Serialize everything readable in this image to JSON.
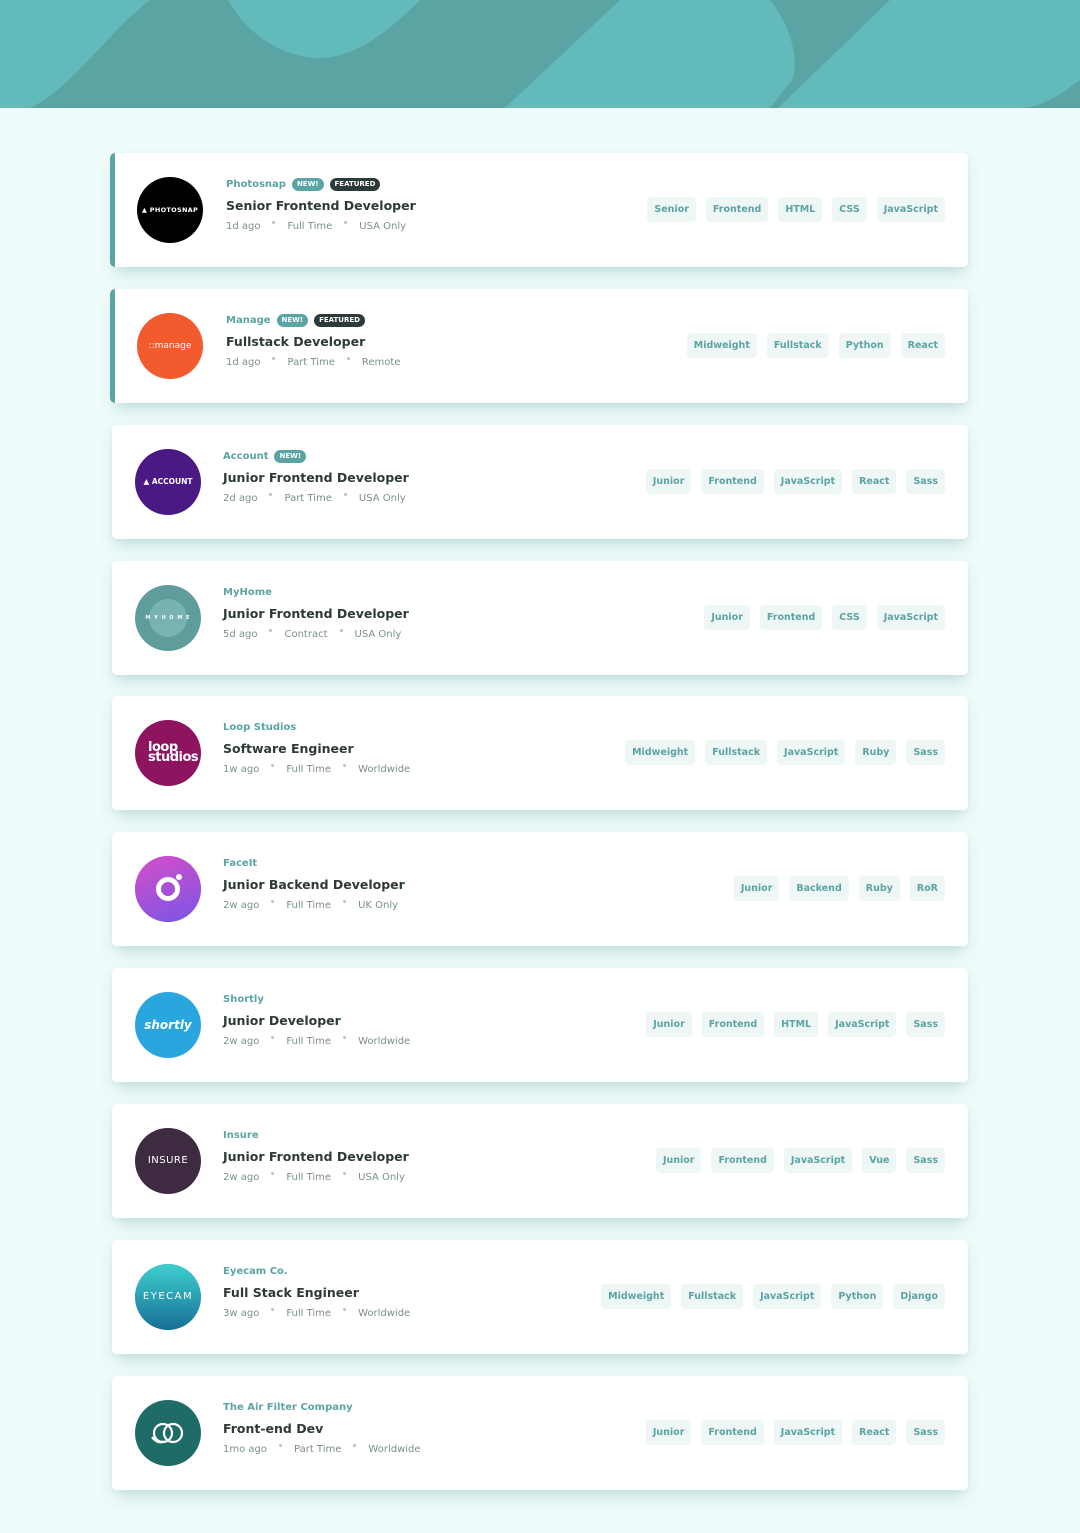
{
  "theme": {
    "primary": "#5ba4a4",
    "dark": "#2c3a3a",
    "background": "#effafa",
    "tag_bg": "#eef6f6"
  },
  "jobs": [
    {
      "company": "Photosnap",
      "new": "NEW!",
      "featured": "FEATURED",
      "position": "Senior Frontend Developer",
      "posted": "1d ago",
      "contract": "Full Time",
      "location": "USA Only",
      "logo": {
        "text": "▲ PHOTOSNAP",
        "color": "#000000",
        "icon": "photosnap-logo-icon"
      },
      "tags": [
        "Senior",
        "Frontend",
        "HTML",
        "CSS",
        "JavaScript"
      ]
    },
    {
      "company": "Manage",
      "new": "NEW!",
      "featured": "FEATURED",
      "position": "Fullstack Developer",
      "posted": "1d ago",
      "contract": "Part Time",
      "location": "Remote",
      "logo": {
        "text": "::manage",
        "color": "#f25b2d",
        "icon": "manage-logo-icon"
      },
      "tags": [
        "Midweight",
        "Fullstack",
        "Python",
        "React"
      ]
    },
    {
      "company": "Account",
      "new": "NEW!",
      "position": "Junior Frontend Developer",
      "posted": "2d ago",
      "contract": "Part Time",
      "location": "USA Only",
      "logo": {
        "text": "▲ ACCOUNT",
        "color": "#4b1984",
        "icon": "account-logo-icon"
      },
      "tags": [
        "Junior",
        "Frontend",
        "JavaScript",
        "React",
        "Sass"
      ]
    },
    {
      "company": "MyHome",
      "position": "Junior Frontend Developer",
      "posted": "5d ago",
      "contract": "Contract",
      "location": "USA Only",
      "logo": {
        "text": "M Y H O M E",
        "color": "#5f9d9c",
        "icon": "myhome-logo-icon"
      },
      "tags": [
        "Junior",
        "Frontend",
        "CSS",
        "JavaScript"
      ]
    },
    {
      "company": "Loop Studios",
      "position": "Software Engineer",
      "posted": "1w ago",
      "contract": "Full Time",
      "location": "Worldwide",
      "logo": {
        "text": "loop studios",
        "color": "#8e1460",
        "icon": "loop-studios-logo-icon"
      },
      "tags": [
        "Midweight",
        "Fullstack",
        "JavaScript",
        "Ruby",
        "Sass"
      ]
    },
    {
      "company": "FaceIt",
      "position": "Junior Backend Developer",
      "posted": "2w ago",
      "contract": "Full Time",
      "location": "UK Only",
      "logo": {
        "text": "",
        "color": "#a24ad8",
        "icon": "faceit-logo-icon"
      },
      "tags": [
        "Junior",
        "Backend",
        "Ruby",
        "RoR"
      ]
    },
    {
      "company": "Shortly",
      "position": "Junior Developer",
      "posted": "2w ago",
      "contract": "Full Time",
      "location": "Worldwide",
      "logo": {
        "text": "shortly",
        "color": "#2aa6de",
        "icon": "shortly-logo-icon"
      },
      "tags": [
        "Junior",
        "Frontend",
        "HTML",
        "JavaScript",
        "Sass"
      ]
    },
    {
      "company": "Insure",
      "position": "Junior Frontend Developer",
      "posted": "2w ago",
      "contract": "Full Time",
      "location": "USA Only",
      "logo": {
        "text": "INSURE",
        "color": "#3e2b42",
        "icon": "insure-logo-icon"
      },
      "tags": [
        "Junior",
        "Frontend",
        "JavaScript",
        "Vue",
        "Sass"
      ]
    },
    {
      "company": "Eyecam Co.",
      "position": "Full Stack Engineer",
      "posted": "3w ago",
      "contract": "Full Time",
      "location": "Worldwide",
      "logo": {
        "text": "EYECAM",
        "color": "#1f9aa6",
        "icon": "eyecam-logo-icon"
      },
      "tags": [
        "Midweight",
        "Fullstack",
        "JavaScript",
        "Python",
        "Django"
      ]
    },
    {
      "company": "The Air Filter Company",
      "position": "Front-end Dev",
      "posted": "1mo ago",
      "contract": "Part Time",
      "location": "Worldwide",
      "logo": {
        "text": "",
        "color": "#1e6b67",
        "icon": "air-filter-logo-icon"
      },
      "tags": [
        "Junior",
        "Frontend",
        "JavaScript",
        "React",
        "Sass"
      ]
    }
  ]
}
